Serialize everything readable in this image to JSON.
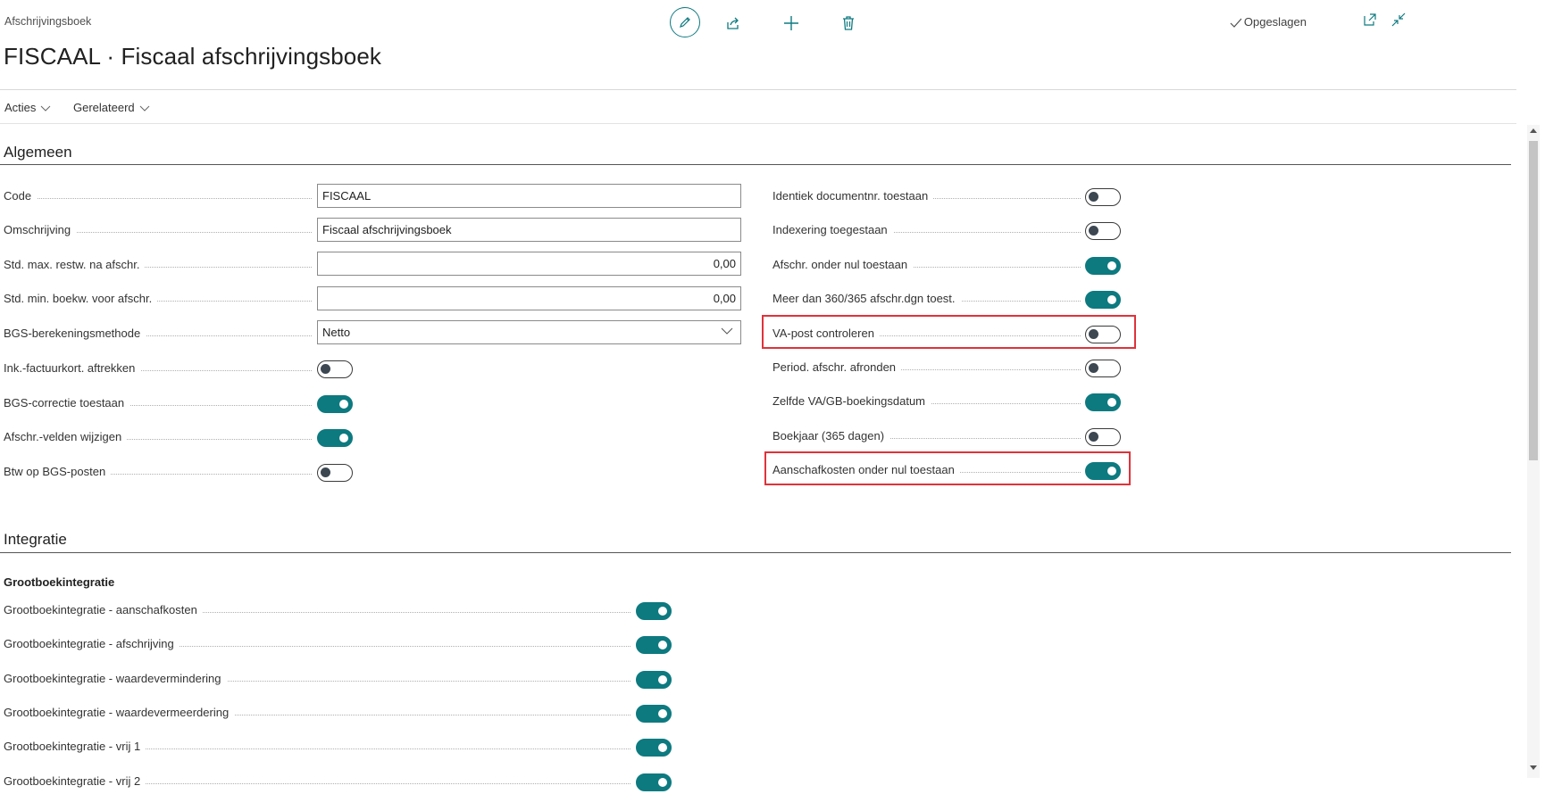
{
  "header": {
    "breadcrumb": "Afschrijvingsboek",
    "title": "FISCAAL · Fiscaal afschrijvingsboek",
    "saved_label": "Opgeslagen"
  },
  "menu": {
    "actions": "Acties",
    "related": "Gerelateerd"
  },
  "toolbar_icons": [
    "edit-icon",
    "share-icon",
    "plus-icon",
    "trash-icon",
    "open-new-window-icon",
    "collapse-icon"
  ],
  "general": {
    "title": "Algemeen",
    "code_label": "Code",
    "code_value": "FISCAAL",
    "description_label": "Omschrijving",
    "description_value": "Fiscaal afschrijvingsboek",
    "max_label": "Std. max. restw. na afschr.",
    "max_value": "0,00",
    "min_label": "Std. min. boekw. voor afschr.",
    "min_value": "0,00",
    "method_label": "BGS-berekeningsmethode",
    "method_value": "Netto",
    "left_toggles": [
      {
        "label": "Ink.-factuurkort. aftrekken",
        "on": false
      },
      {
        "label": "BGS-correctie toestaan",
        "on": true
      },
      {
        "label": "Afschr.-velden wijzigen",
        "on": true
      },
      {
        "label": "Btw op BGS-posten",
        "on": false
      }
    ],
    "right_toggles": [
      {
        "label": "Identiek documentnr. toestaan",
        "on": false
      },
      {
        "label": "Indexering toegestaan",
        "on": false
      },
      {
        "label": "Afschr. onder nul toestaan",
        "on": true
      },
      {
        "label": "Meer dan 360/365 afschr.dgn toest.",
        "on": true
      },
      {
        "label": "VA-post controleren",
        "on": false
      },
      {
        "label": "Period. afschr. afronden",
        "on": false
      },
      {
        "label": "Zelfde VA/GB-boekingsdatum",
        "on": true
      },
      {
        "label": "Boekjaar (365 dagen)",
        "on": false
      },
      {
        "label": "Aanschafkosten onder nul toestaan",
        "on": true
      }
    ]
  },
  "integration": {
    "title": "Integratie",
    "subheading": "Grootboekintegratie",
    "toggles": [
      {
        "label": "Grootboekintegratie - aanschafkosten",
        "on": true
      },
      {
        "label": "Grootboekintegratie - afschrijving",
        "on": true
      },
      {
        "label": "Grootboekintegratie - waardevermindering",
        "on": true
      },
      {
        "label": "Grootboekintegratie - waardevermeerdering",
        "on": true
      },
      {
        "label": "Grootboekintegratie - vrij 1",
        "on": true
      },
      {
        "label": "Grootboekintegratie - vrij 2",
        "on": true
      }
    ]
  },
  "colors": {
    "accent": "#0d7a80",
    "highlight": "#e0323a"
  }
}
